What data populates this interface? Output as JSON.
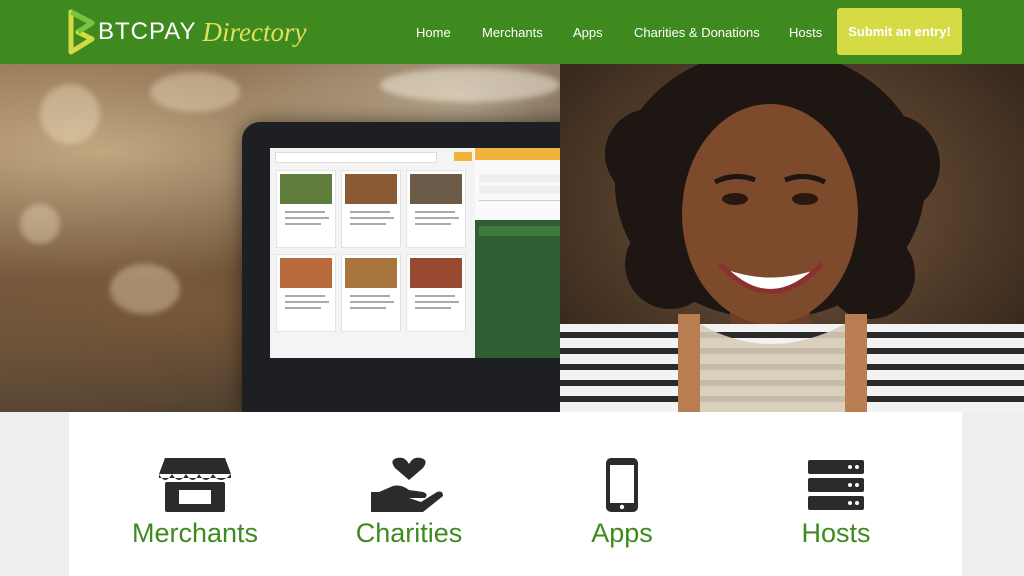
{
  "brand": {
    "logo_text": "BTCPAY",
    "logo_script": "Directory"
  },
  "nav": {
    "items": [
      {
        "label": "Home"
      },
      {
        "label": "Merchants"
      },
      {
        "label": "Apps"
      },
      {
        "label": "Charities & Donations"
      },
      {
        "label": "Hosts"
      }
    ],
    "submit_label": "Submit an entry!"
  },
  "hero": {
    "image_description_icon": "hero-photo"
  },
  "categories": [
    {
      "label": "Merchants",
      "icon": "store-icon"
    },
    {
      "label": "Charities",
      "icon": "heart-hand-icon"
    },
    {
      "label": "Apps",
      "icon": "smartphone-icon"
    },
    {
      "label": "Hosts",
      "icon": "server-icon"
    }
  ],
  "colors": {
    "header_bg": "#3f8a1f",
    "submit_bg": "#d4db45",
    "accent_green": "#3f8a1f",
    "icon_dark": "#2b2b2b"
  }
}
